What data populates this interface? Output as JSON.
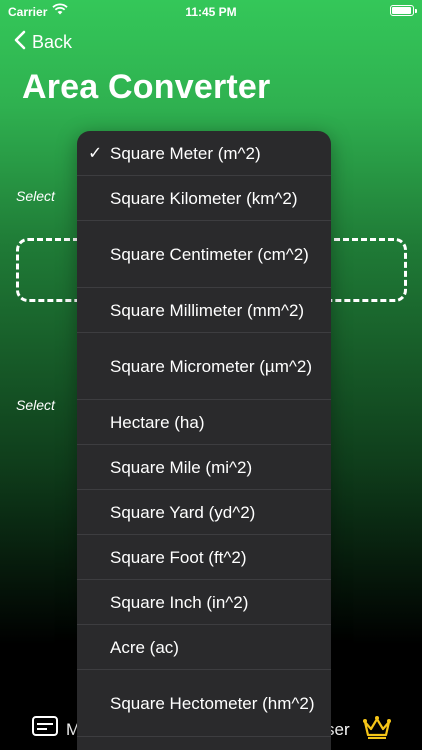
{
  "status": {
    "carrier": "Carrier",
    "time": "11:45 PM",
    "battery_level": 0.95
  },
  "nav": {
    "back_label": "Back",
    "title": "Area Converter"
  },
  "form": {
    "select_label_1": "Select",
    "select_label_2": "Select"
  },
  "bottom": {
    "left_text": "M",
    "right_text": "ser"
  },
  "menu": {
    "selected_index": 0,
    "items": [
      "Square Meter (m^2)",
      "Square Kilometer (km^2)",
      "Square Centimeter (cm^2)",
      "Square Millimeter (mm^2)",
      "Square Micrometer (µm^2)",
      "Hectare (ha)",
      "Square Mile (mi^2)",
      "Square Yard (yd^2)",
      "Square Foot (ft^2)",
      "Square Inch (in^2)",
      "Acre (ac)",
      "Square Hectometer (hm^2)"
    ]
  },
  "icons": {
    "back": "chevron-left-icon",
    "checkmark": "checkmark-icon",
    "card": "card-icon",
    "crown": "crown-icon",
    "wifi": "wifi-icon",
    "battery": "battery-icon"
  },
  "colors": {
    "accent": "#34c759",
    "menu_bg": "#2a2a2c",
    "crown": "#f5c518"
  }
}
